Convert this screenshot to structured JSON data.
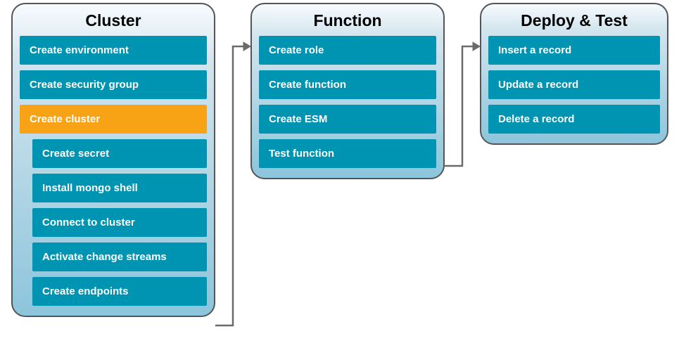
{
  "panels": {
    "cluster": {
      "title": "Cluster",
      "items": [
        "Create environment",
        "Create security group",
        "Create cluster",
        "Create secret",
        "Install mongo shell",
        "Connect to cluster",
        "Activate change streams",
        "Create endpoints"
      ],
      "highlight_index": 2
    },
    "function": {
      "title": "Function",
      "items": [
        "Create role",
        "Create function",
        "Create ESM",
        "Test function"
      ]
    },
    "deploy": {
      "title": "Deploy & Test",
      "items": [
        "Insert a record",
        "Update a record",
        "Delete a record"
      ]
    }
  },
  "colors": {
    "item_bg": "#0094b3",
    "highlight_bg": "#f7a315",
    "item_text": "#ffffff",
    "title_text": "#000000",
    "arrow": "#6a6a6a"
  }
}
